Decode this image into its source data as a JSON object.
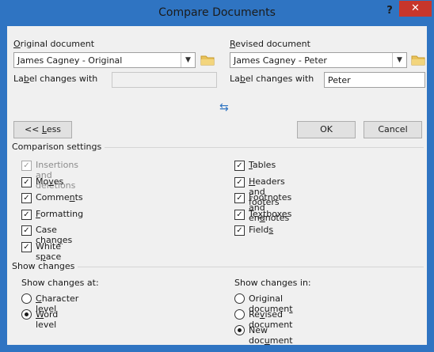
{
  "window": {
    "title": "Compare Documents",
    "help": "?",
    "close": "✕"
  },
  "original": {
    "heading_first": "O",
    "heading_rest": "riginal document",
    "value": "James Cagney - Original",
    "label_changes_a": "La",
    "label_changes_u": "b",
    "label_changes_b": "el changes with",
    "label_value": ""
  },
  "revised": {
    "heading_first": "R",
    "heading_rest": "evised document",
    "value": "James Cagney - Peter",
    "label_changes_a": "La",
    "label_changes_u": "b",
    "label_changes_b": "el changes with",
    "label_value": "Peter"
  },
  "buttons": {
    "less_a": "<< ",
    "less_u": "L",
    "less_b": "ess",
    "ok": "OK",
    "cancel": "Cancel"
  },
  "comparison": {
    "title": "Comparison settings",
    "insertions": "Insertions and deletions",
    "moves_a": "Mo",
    "moves_u": "v",
    "moves_b": "es",
    "comments_a": "Comme",
    "comments_u": "n",
    "comments_b": "ts",
    "formatting_a": "",
    "formatting_u": "F",
    "formatting_b": "ormatting",
    "case_a": "Case chan",
    "case_u": "g",
    "case_b": "es",
    "whitespace_a": "White s",
    "whitespace_u": "p",
    "whitespace_b": "ace",
    "tables_a": "",
    "tables_u": "T",
    "tables_b": "ables",
    "headers_a": "",
    "headers_u": "H",
    "headers_b": "eaders and footers",
    "footnotes_a": "Footnotes and en",
    "footnotes_u": "d",
    "footnotes_b": "notes",
    "textboxes_a": "Te",
    "textboxes_u": "x",
    "textboxes_b": "tboxes",
    "fields_a": "Field",
    "fields_u": "s",
    "fields_b": ""
  },
  "show": {
    "title": "Show changes",
    "at_heading": "Show changes at:",
    "char_a": "",
    "char_u": "C",
    "char_b": "haracter level",
    "word_a": "",
    "word_u": "W",
    "word_b": "ord level",
    "in_heading": "Show changes in:",
    "orig_a": "Original documen",
    "orig_u": "t",
    "orig_b": "",
    "rev_a": "Re",
    "rev_u": "v",
    "rev_b": "ised document",
    "new_a": "New doc",
    "new_u": "u",
    "new_b": "ment"
  }
}
